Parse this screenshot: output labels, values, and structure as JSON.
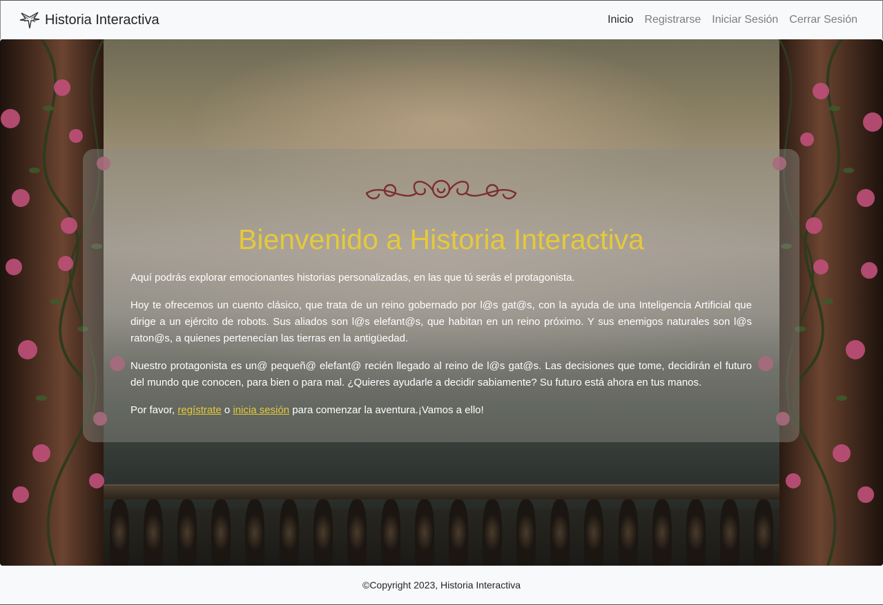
{
  "brand": {
    "icon": "tree-icon",
    "name": "Historia Interactiva"
  },
  "nav": {
    "items": [
      {
        "label": "Inicio",
        "active": true
      },
      {
        "label": "Registrarse",
        "active": false
      },
      {
        "label": "Iniciar Sesión",
        "active": false
      },
      {
        "label": "Cerrar Sesión",
        "active": false
      }
    ]
  },
  "hero": {
    "title": "Bienvenido a Historia Interactiva",
    "paragraphs": [
      "Aquí podrás explorar emocionantes historias personalizadas, en las que tú serás el protagonista.",
      "Hoy te ofrecemos un cuento clásico, que trata de un reino gobernado por l@s gat@s, con la ayuda de una Inteligencia Artificial que dirige a un ejército de robots. Sus aliados son l@s elefant@s, que habitan en un reino próximo. Y sus enemigos naturales son l@s raton@s, a quienes pertenecían las tierras en la antigüedad.",
      "Nuestro protagonista es un@ pequeñ@ elefant@ recién llegado al reino de l@s gat@s. Las decisiones que tome, decidirán el futuro del mundo que conocen, para bien o para mal. ¿Quieres ayudarle a decidir sabiamente? Su futuro está ahora en tus manos."
    ],
    "cta": {
      "prefix": "Por favor, ",
      "register_link": "regístrate",
      "middle": " o ",
      "login_link": "inicia sesión",
      "suffix": " para comenzar la aventura.¡Vamos a ello!"
    }
  },
  "footer": {
    "text": "©Copyright 2023, Historia Interactiva"
  },
  "colors": {
    "accent": "#e6c93a",
    "ornament": "#7a2f2f",
    "navbar_bg": "#f8f9fa"
  }
}
